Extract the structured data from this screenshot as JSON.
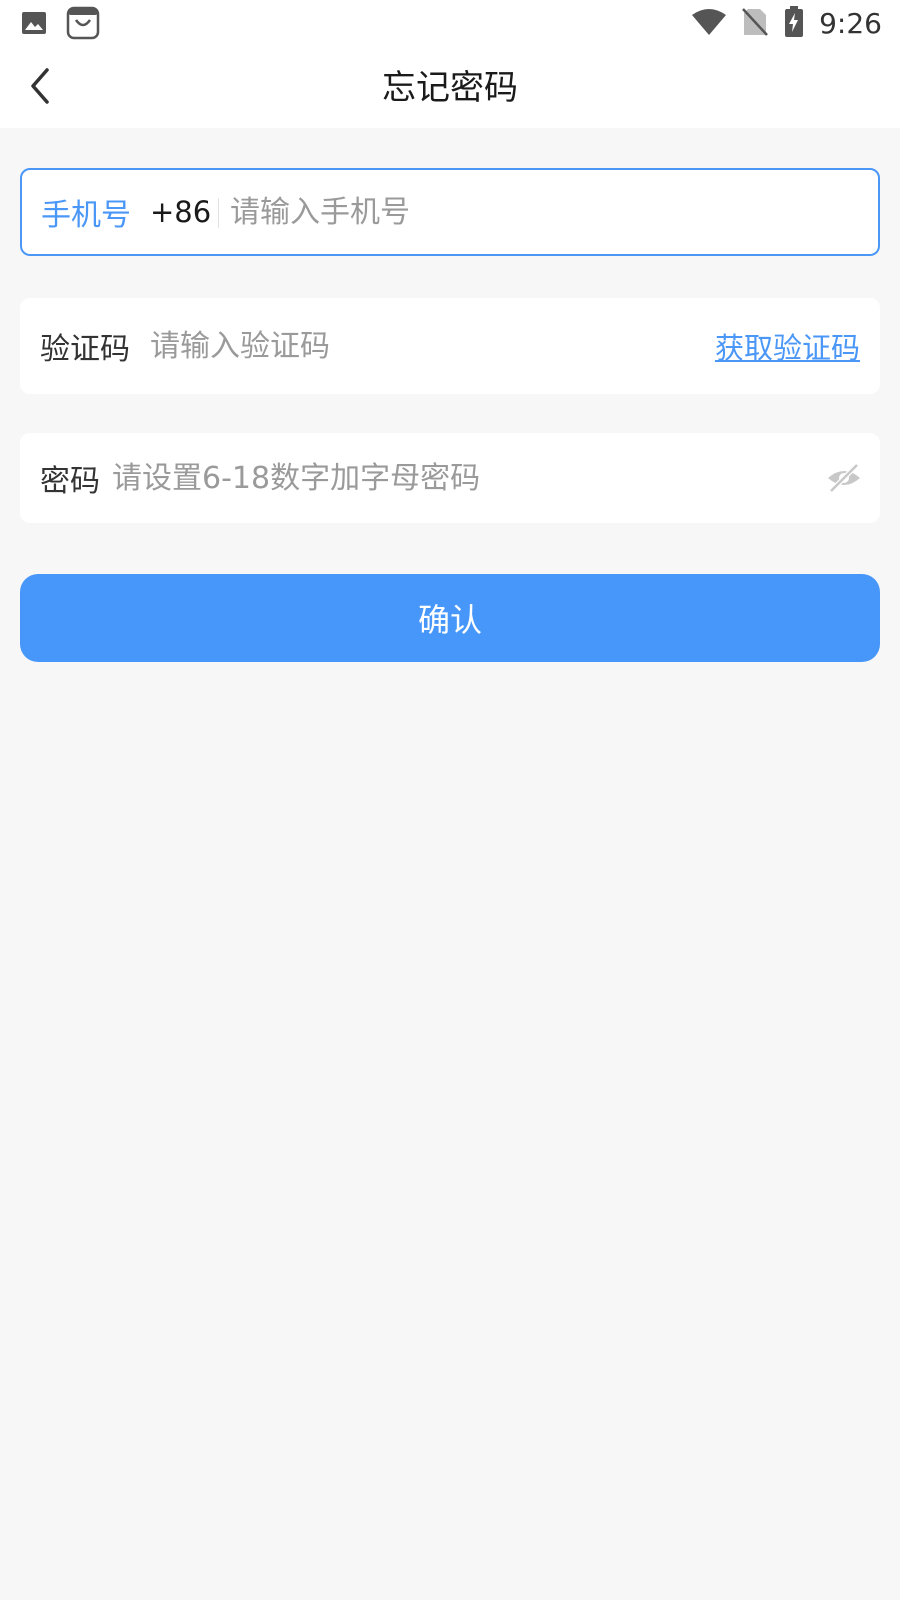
{
  "status_bar": {
    "time": "9:26",
    "icons": [
      "image-icon",
      "shopping-bag-icon",
      "wifi-icon",
      "no-sim-icon",
      "battery-charging-icon"
    ]
  },
  "header": {
    "title": "忘记密码",
    "back_icon": "chevron-left-icon"
  },
  "form": {
    "phone": {
      "label": "手机号",
      "country_code": "+86",
      "placeholder": "请输入手机号",
      "value": ""
    },
    "code": {
      "label": "验证码",
      "placeholder": "请输入验证码",
      "value": "",
      "get_code_label": "获取验证码"
    },
    "password": {
      "label": "密码",
      "placeholder": "请设置6-18数字加字母密码",
      "value": "",
      "toggle_icon": "eye-off-icon"
    },
    "confirm_label": "确认"
  },
  "colors": {
    "accent": "#4a97f7",
    "button": "#4797fb",
    "background": "#f7f7f7",
    "placeholder": "#9a9a9a"
  }
}
